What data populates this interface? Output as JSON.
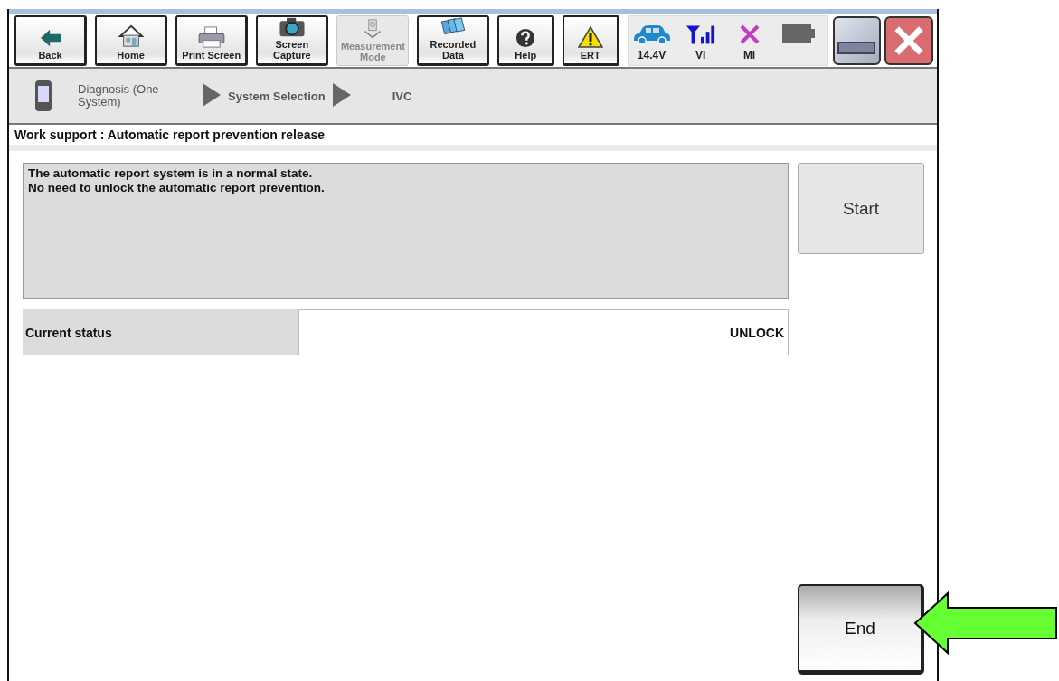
{
  "toolbar": {
    "buttons": [
      {
        "label": "Back",
        "disabled": false
      },
      {
        "label": "Home",
        "disabled": false
      },
      {
        "label": "Print Screen",
        "disabled": false
      },
      {
        "label": "Screen Capture",
        "disabled": false
      },
      {
        "label": "Measurement Mode",
        "disabled": true
      },
      {
        "label": "Recorded Data",
        "disabled": false
      },
      {
        "label": "Help",
        "disabled": false
      },
      {
        "label": "ERT",
        "disabled": false
      }
    ],
    "status": [
      {
        "label": "14.4V"
      },
      {
        "label": "VI"
      },
      {
        "label": "MI"
      }
    ]
  },
  "breadcrumb": [
    "Diagnosis (One System)",
    "System Selection",
    "IVC"
  ],
  "page_title": "Work support : Automatic report prevention release",
  "message": [
    "The automatic report system is in a normal state.",
    "No need to unlock the automatic report prevention."
  ],
  "start_button": {
    "label": "Start",
    "disabled": true
  },
  "status_row": {
    "label": "Current status",
    "value": "UNLOCK"
  },
  "end_button": {
    "label": "End"
  }
}
